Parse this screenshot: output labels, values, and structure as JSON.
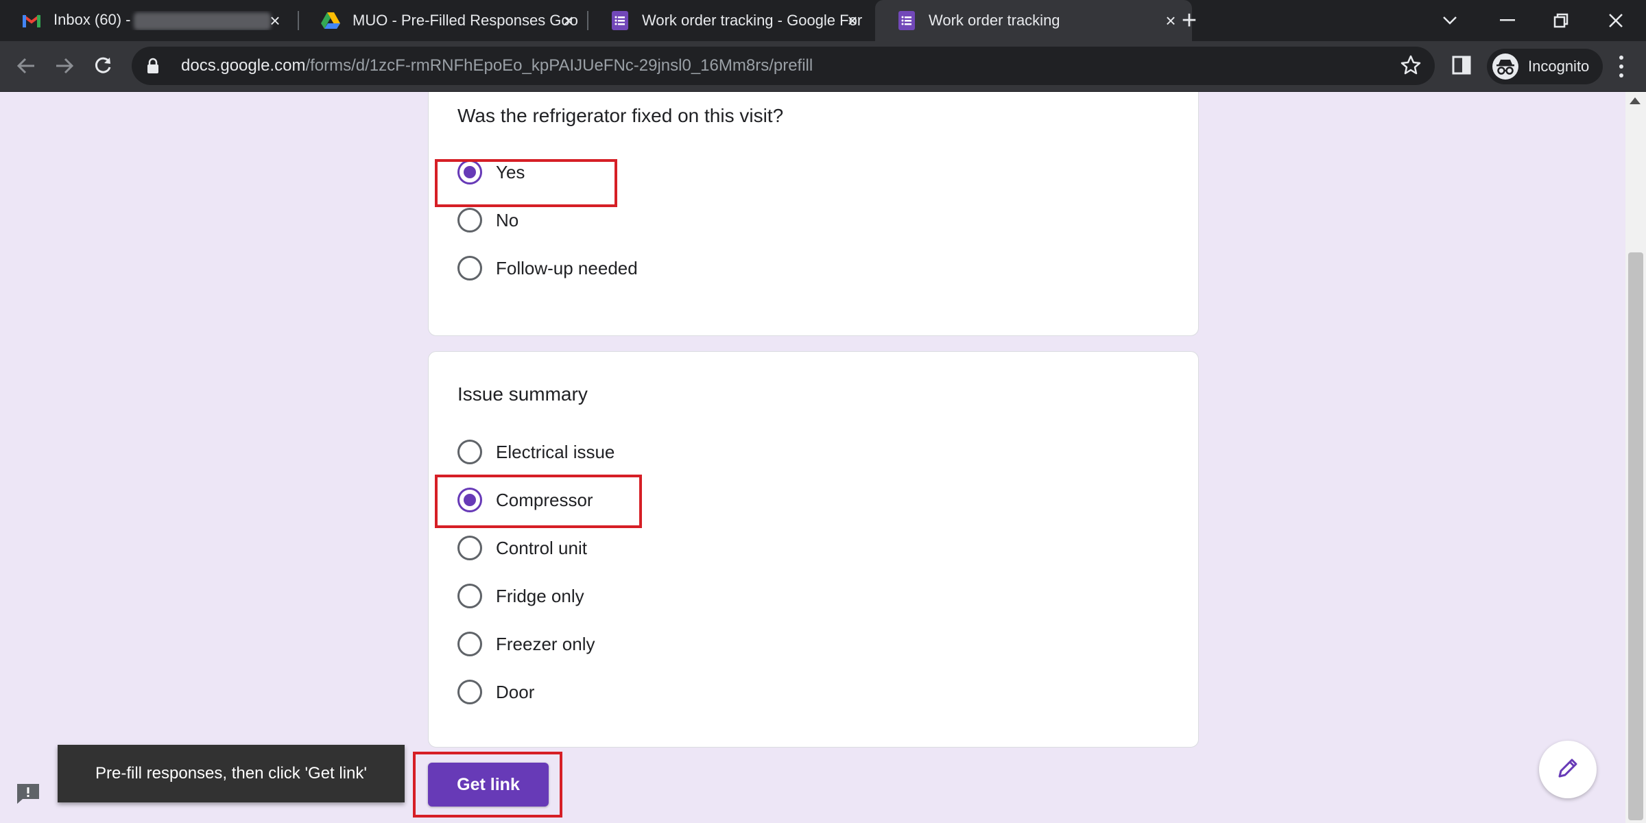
{
  "browser": {
    "tabs": [
      {
        "title": "Inbox (60) -",
        "active": false,
        "icon": "gmail-icon"
      },
      {
        "title": "MUO - Pre-Filled Responses Goo",
        "active": false,
        "icon": "google-drive-icon"
      },
      {
        "title": "Work order tracking - Google For",
        "active": false,
        "icon": "google-forms-icon"
      },
      {
        "title": "Work order tracking",
        "active": true,
        "icon": "google-forms-icon"
      }
    ],
    "url_host": "docs.google.com",
    "url_path": "/forms/d/1zcF-rmRNFhEpoEo_kpPAIJUeFNc-29jnsl0_16Mm8rs/prefill",
    "profile_label": "Incognito"
  },
  "form": {
    "question1": {
      "text": "Was the refrigerator fixed on this visit?",
      "options": [
        "Yes",
        "No",
        "Follow-up needed"
      ],
      "selected": "Yes"
    },
    "question2": {
      "text": "Issue summary",
      "options": [
        "Electrical issue",
        "Compressor",
        "Control unit",
        "Fridge only",
        "Freezer only",
        "Door"
      ],
      "selected": "Compressor"
    },
    "get_link_label": "Get link"
  },
  "toast": {
    "text": "Pre-fill responses, then click 'Get link'"
  },
  "colors": {
    "accent": "#673ab7",
    "highlight": "#d61f26",
    "page_bg": "#ede6f6"
  }
}
